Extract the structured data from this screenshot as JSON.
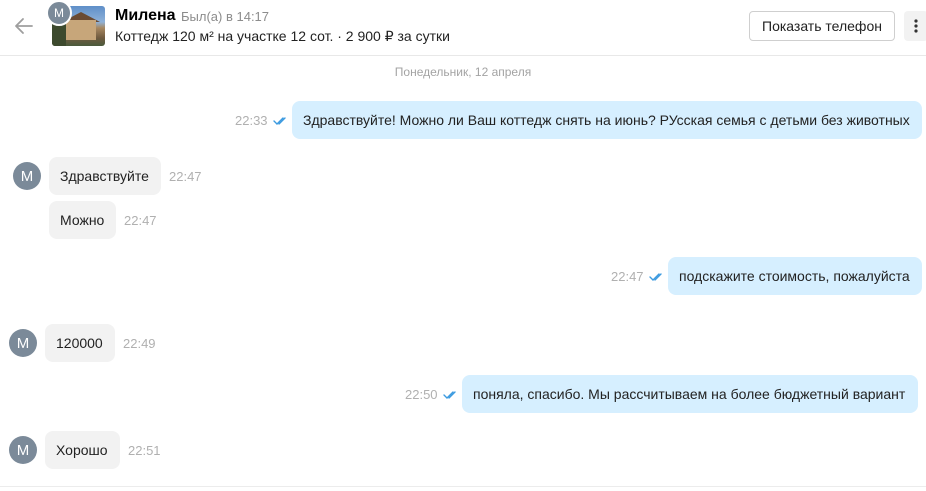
{
  "header": {
    "contact_name": "Милена",
    "last_seen": "Был(а) в 14:17",
    "listing": "Коттедж 120 м² на участке 12 сот. · 2 900 ₽ за сутки",
    "avatar_letter": "М",
    "show_phone_label": "Показать телефон"
  },
  "chat": {
    "date_divider": "Понедельник, 12 апреля",
    "messages": [
      {
        "direction": "outgoing",
        "text": "Здравствуйте! Можно ли Ваш коттедж снять на июнь? РУсская семья с детьми без животных",
        "time": "22:33",
        "read": true
      },
      {
        "direction": "incoming",
        "text": "Здравствуйте",
        "time": "22:47",
        "avatar": "М"
      },
      {
        "direction": "incoming",
        "text": "Можно",
        "time": "22:47"
      },
      {
        "direction": "outgoing",
        "text": "подскажите стоимость, пожалуйста",
        "time": "22:47",
        "read": true
      },
      {
        "direction": "incoming",
        "text": "120000",
        "time": "22:49",
        "avatar": "М"
      },
      {
        "direction": "outgoing",
        "text": "поняла, спасибо. Мы рассчитываем на более бюджетный вариант",
        "time": "22:50",
        "read": true
      },
      {
        "direction": "incoming",
        "text": "Хорошо",
        "time": "22:51",
        "avatar": "М"
      }
    ]
  },
  "colors": {
    "outgoing_bubble": "#d6efff",
    "incoming_bubble": "#f2f2f2",
    "read_check": "#3d9be0",
    "avatar_bg": "#7b8a99"
  },
  "icons": {
    "back": "arrow-left-icon",
    "more": "vertical-dots-icon",
    "read": "double-check-icon"
  }
}
